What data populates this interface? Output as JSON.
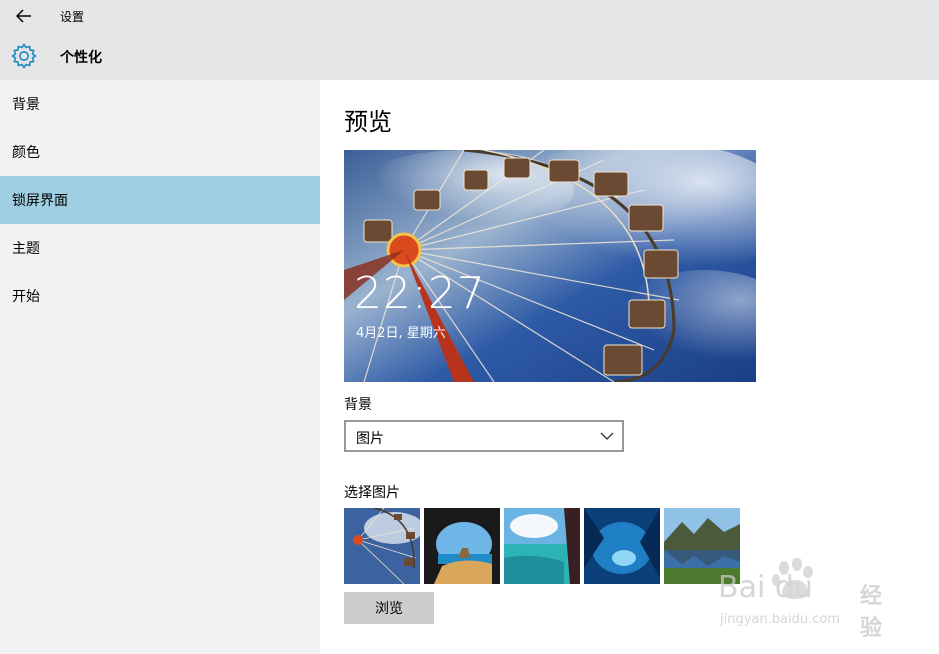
{
  "titlebar": {
    "title": "设置",
    "back_icon": "back-arrow-icon"
  },
  "header": {
    "title": "个性化",
    "icon": "gear-icon",
    "accent": "#1f8ac0"
  },
  "sidebar": {
    "items": [
      {
        "label": "背景"
      },
      {
        "label": "颜色"
      },
      {
        "label": "锁屏界面",
        "active": true
      },
      {
        "label": "主题"
      },
      {
        "label": "开始"
      }
    ],
    "active_color": "#9ecfe2"
  },
  "main": {
    "title": "预览",
    "lock_time": "22:27",
    "lock_date": "4月2日, 星期六",
    "background_label": "背景",
    "background_value": "图片",
    "choose_label": "选择图片",
    "browse_label": "浏览"
  },
  "watermark": {
    "brand": "Bai du",
    "brand_suffix": "经验",
    "url": "jingyan.baidu.com"
  }
}
